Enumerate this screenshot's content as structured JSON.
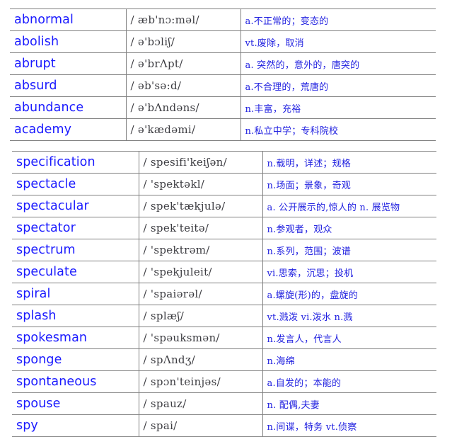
{
  "document": {
    "type": "vocabulary-reference-table",
    "columns": [
      "word",
      "phonetic",
      "definition"
    ],
    "text_colors": {
      "word": "#1a1aff",
      "phonetic": "#3c3c41",
      "definition": "#2222e0",
      "border": "#808080",
      "background": "#ffffff"
    }
  },
  "table_one": {
    "rows": [
      {
        "word": "abnormal",
        "phonetic": "/ æb'nɔ:məl/",
        "definition": "a.不正常的；变态的"
      },
      {
        "word": "abolish",
        "phonetic": "/ ə'bɔliʃ/",
        "definition": "vt.废除，取消"
      },
      {
        "word": "abrupt",
        "phonetic": "/ ə'brΛpt/",
        "definition": "a. 突然的，意外的，唐突的"
      },
      {
        "word": "absurd",
        "phonetic": "/ əb'sə:d/",
        "definition": "a.不合理的，荒唐的"
      },
      {
        "word": "abundance",
        "phonetic": "/ ə'bΛndəns/",
        "definition": "n.丰富，充裕"
      },
      {
        "word": "academy",
        "phonetic": "/ ə'kædəmi/",
        "definition": "n.私立中学；专科院校"
      }
    ]
  },
  "table_two": {
    "rows": [
      {
        "word": "specification",
        "phonetic": "/ spesifi'keiʃən/",
        "definition": "n.载明，详述；规格"
      },
      {
        "word": "spectacle",
        "phonetic": "/ 'spektəkl/",
        "definition": "n.场面；景象，奇观"
      },
      {
        "word": "spectacular",
        "phonetic": "/ spek'tækjulə/",
        "definition": "a. 公开展示的,惊人的 n. 展览物"
      },
      {
        "word": "spectator",
        "phonetic": "/ spek'teitə/",
        "definition": "n.参观者，观众"
      },
      {
        "word": "spectrum",
        "phonetic": "/ 'spektrəm/",
        "definition": "n.系列，范围；波谱"
      },
      {
        "word": "speculate",
        "phonetic": "/ 'spekjuleit/",
        "definition": "vi.思索，沉思；投机"
      },
      {
        "word": "spiral",
        "phonetic": "/ 'spaiərəl/",
        "definition": "a.螺旋(形)的，盘旋的"
      },
      {
        "word": "splash",
        "phonetic": "/ splæʃ/",
        "definition": "vt.溅泼 vi.泼水 n.溅"
      },
      {
        "word": "spokesman",
        "phonetic": "/ 'spəuksmən/",
        "definition": "n.发言人，代言人"
      },
      {
        "word": "sponge",
        "phonetic": "/ spΛndʒ/",
        "definition": "n.海绵"
      },
      {
        "word": "spontaneous",
        "phonetic": "/ spɔn'teinjəs/",
        "definition": "a.自发的；本能的"
      },
      {
        "word": "spouse",
        "phonetic": "/ spauz/",
        "definition": "n. 配偶,夫妻"
      },
      {
        "word": "spy",
        "phonetic": "/ spai/",
        "definition": "n.间谍，特务 vt.侦察"
      }
    ]
  }
}
